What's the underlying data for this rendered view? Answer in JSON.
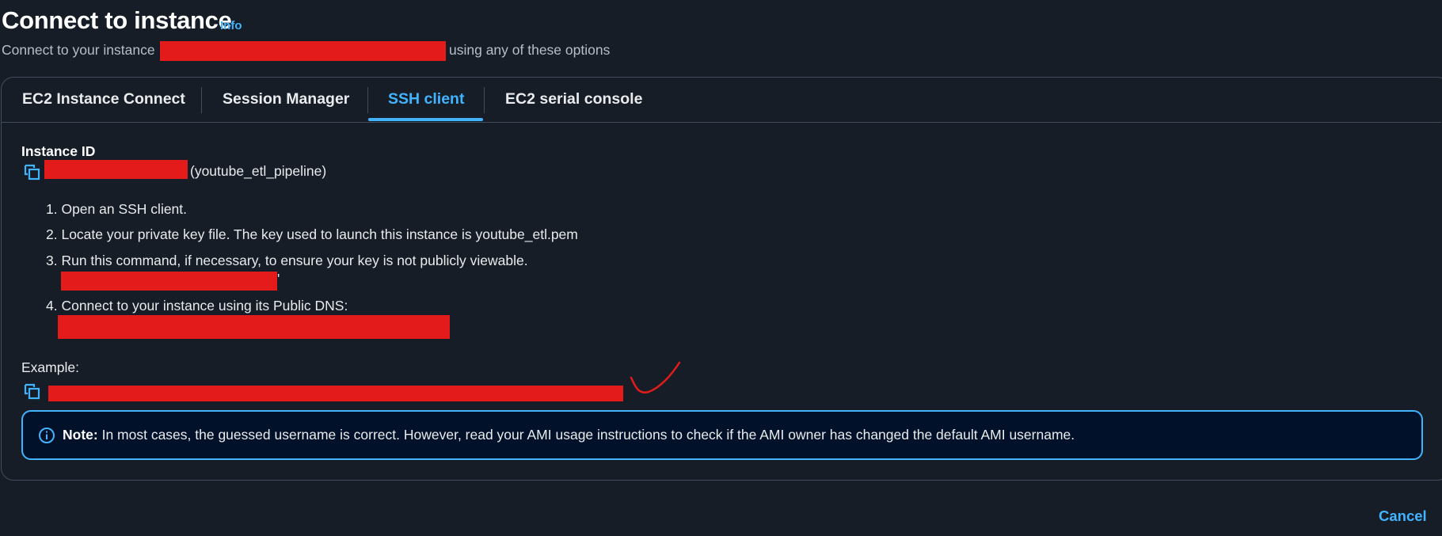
{
  "header": {
    "title": "Connect to instance",
    "info_link": "Info",
    "subtitle_prefix": "Connect to your instance",
    "subtitle_suffix": "using any of these options"
  },
  "tabs": [
    {
      "label": "EC2 Instance Connect",
      "active": false
    },
    {
      "label": "Session Manager",
      "active": false
    },
    {
      "label": "SSH client",
      "active": true
    },
    {
      "label": "EC2 serial console",
      "active": false
    }
  ],
  "instance": {
    "label": "Instance ID",
    "name": "(youtube_etl_pipeline)"
  },
  "steps": [
    "1. Open an SSH client.",
    "2. Locate your private key file. The key used to launch this instance is youtube_etl.pem",
    "3. Run this command, if necessary, to ensure your key is not publicly viewable.",
    "4. Connect to your instance using its Public DNS:"
  ],
  "step3_suffix": "'",
  "example": {
    "label": "Example:"
  },
  "note": {
    "bold": "Note:",
    "text": " In most cases, the guessed username is correct. However, read your AMI usage instructions to check if the AMI owner has changed the default AMI username."
  },
  "footer": {
    "cancel_label": "Cancel"
  },
  "colors": {
    "background": "#161d26",
    "accent": "#42b4ff",
    "redaction": "#e31b1b",
    "note_background": "#001129",
    "border": "#414d5c"
  },
  "icons": {
    "copy": "copy-icon",
    "info": "info-circle-icon",
    "annotation": "checkmark-icon"
  }
}
